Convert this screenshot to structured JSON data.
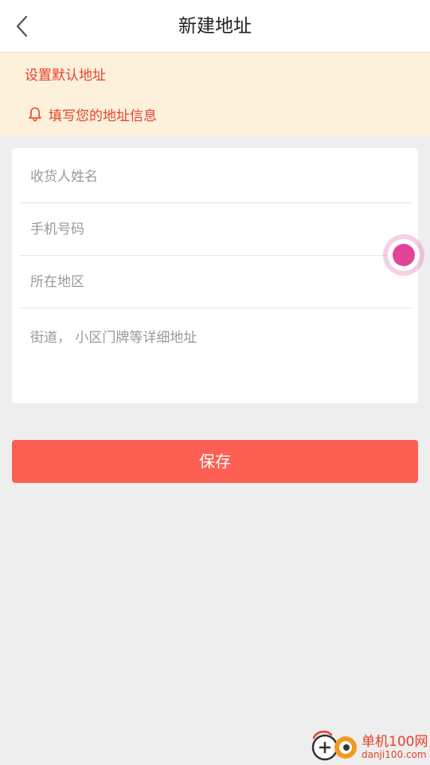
{
  "header": {
    "title": "新建地址",
    "back_icon": "chevron-left-icon"
  },
  "notice": {
    "set_default_label": "设置默认地址",
    "info_text": "填写您的地址信息",
    "info_icon": "bell-icon"
  },
  "form": {
    "name_placeholder": "收货人姓名",
    "phone_placeholder": "手机号码",
    "region_placeholder": "所在地区",
    "street_placeholder": "街道， 小区门牌等详细地址"
  },
  "actions": {
    "save_label": "保存"
  },
  "watermark": {
    "title": "单机100网",
    "url": "danji100.com"
  },
  "colors": {
    "accent": "#e8402c",
    "notice_bg": "#fdf1dc",
    "save_button": "#fd5f52",
    "page_bg": "#eeeeee",
    "touch_indicator": "#e0459a"
  }
}
